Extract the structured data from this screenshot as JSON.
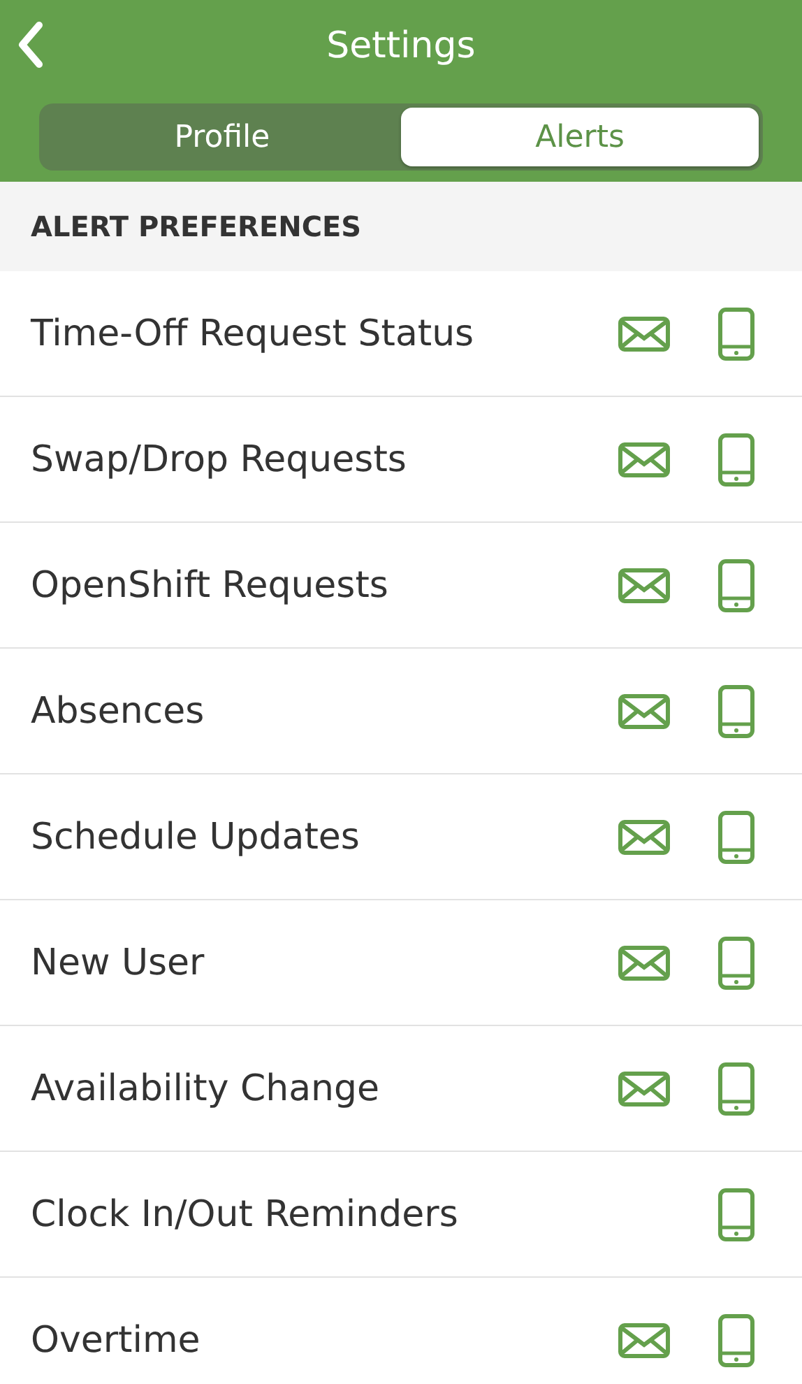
{
  "header": {
    "title": "Settings"
  },
  "tabs": [
    {
      "label": "Profile",
      "selected": false
    },
    {
      "label": "Alerts",
      "selected": true
    }
  ],
  "section": {
    "title": "ALERT PREFERENCES"
  },
  "alerts": [
    {
      "label": "Time-Off Request Status",
      "email": true,
      "push": true
    },
    {
      "label": "Swap/Drop Requests",
      "email": true,
      "push": true
    },
    {
      "label": "OpenShift Requests",
      "email": true,
      "push": true
    },
    {
      "label": "Absences",
      "email": true,
      "push": true
    },
    {
      "label": "Schedule Updates",
      "email": true,
      "push": true
    },
    {
      "label": "New User",
      "email": true,
      "push": true
    },
    {
      "label": "Availability Change",
      "email": true,
      "push": true
    },
    {
      "label": "Clock In/Out Reminders",
      "email": false,
      "push": true
    },
    {
      "label": "Overtime",
      "email": true,
      "push": true
    }
  ]
}
